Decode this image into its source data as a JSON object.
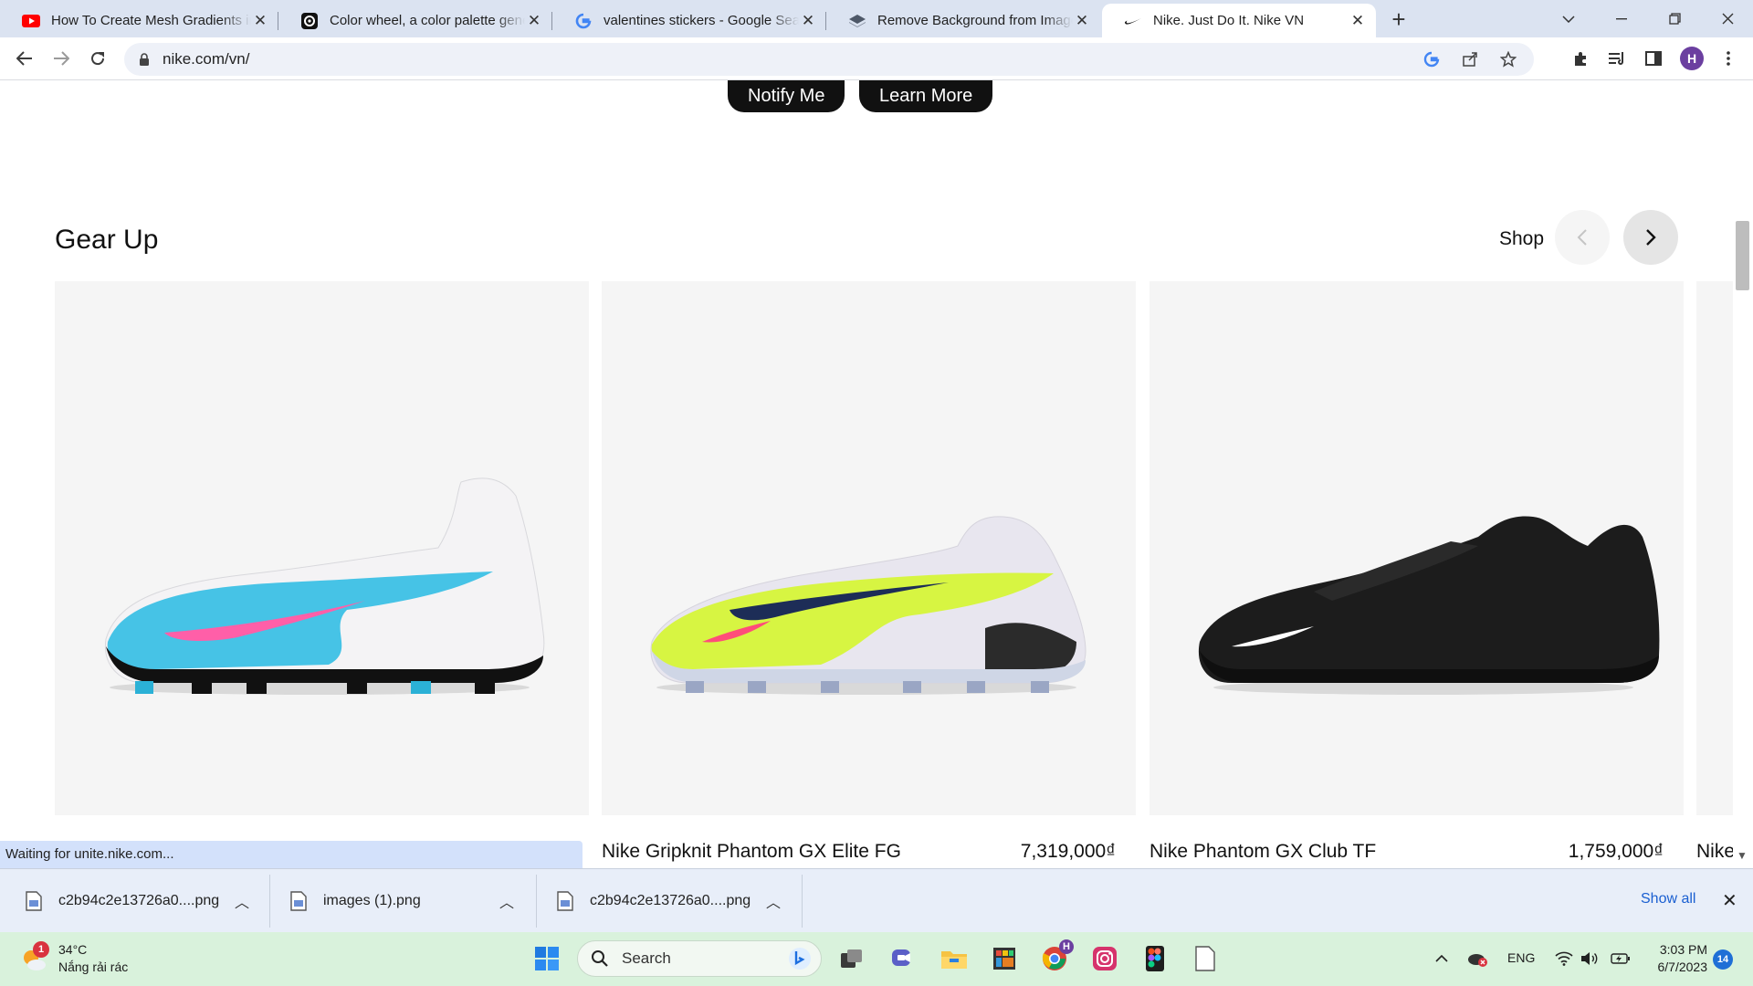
{
  "browser": {
    "tabs": [
      {
        "title": "How To Create Mesh Gradients in",
        "icon": "youtube-icon"
      },
      {
        "title": "Color wheel, a color palette gene",
        "icon": "canva-color-icon"
      },
      {
        "title": "valentines stickers - Google Search",
        "icon": "google-icon"
      },
      {
        "title": "Remove Background from Image",
        "icon": "remove-bg-icon"
      },
      {
        "title": "Nike. Just Do It. Nike VN",
        "icon": "nike-swoosh-icon"
      }
    ],
    "url": "nike.com/vn/",
    "profile_initial": "H"
  },
  "page": {
    "buttons": {
      "notify": "Notify Me",
      "learn_more": "Learn More"
    },
    "section_title": "Gear Up",
    "shop_label": "Shop",
    "products": [
      {
        "name": "",
        "price": "",
        "colors": [
          "#ffffff",
          "#46c3e6",
          "#ff5fa8"
        ]
      },
      {
        "name": "Nike Gripknit Phantom GX Elite FG",
        "price": "7,319,000₫",
        "colors": [
          "#e8e6ef",
          "#d7f542",
          "#1d2d57"
        ]
      },
      {
        "name": "Nike Phantom GX Club TF",
        "price": "1,759,000₫",
        "colors": [
          "#1c1c1c",
          "#2a2a2a",
          "#ffffff"
        ]
      },
      {
        "name": "Nike",
        "price": ""
      }
    ],
    "status": "Waiting for unite.nike.com..."
  },
  "downloads": {
    "items": [
      "c2b94c2e13726a0....png",
      "images (1).png",
      "c2b94c2e13726a0....png"
    ],
    "show_all": "Show all"
  },
  "taskbar": {
    "weather": {
      "temp": "34°C",
      "desc": "Nắng rải rác",
      "alert_count": "1"
    },
    "search_placeholder": "Search",
    "chrome_profile": "H",
    "language": "ENG",
    "time": "3:03 PM",
    "date": "6/7/2023",
    "notification_count": "14"
  }
}
